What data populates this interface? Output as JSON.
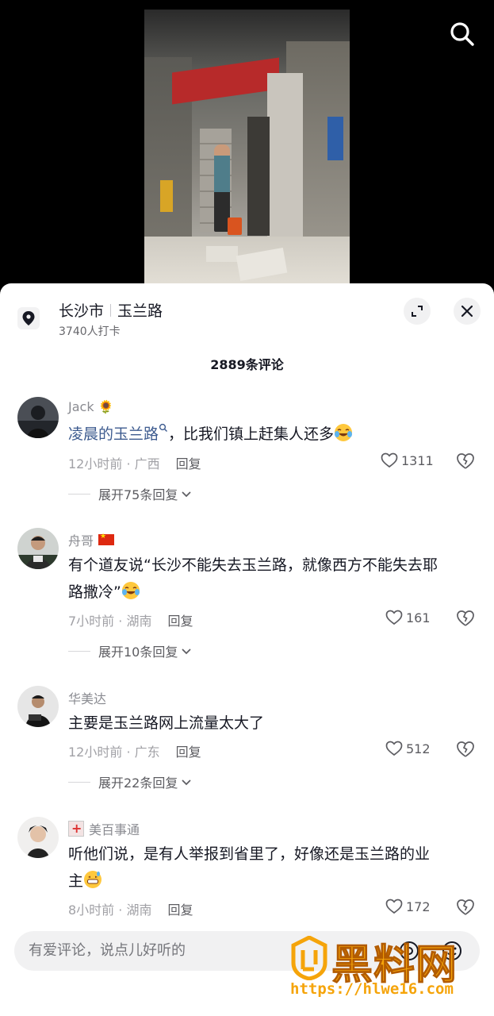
{
  "location": {
    "city": "长沙市",
    "road": "玉兰路",
    "checkins": "3740人打卡"
  },
  "comment_count": "2889条评论",
  "comments": [
    {
      "author": "Jack",
      "badge": "🌻",
      "text_link": "凌晨的玉兰路",
      "text_rest": "，比我们镇上赶集人还多",
      "time_region": "12小时前 · 广西",
      "reply": "回复",
      "likes": "1311",
      "expand": "展开75条回复"
    },
    {
      "author": "舟哥",
      "text_line1": "有个道友说“长沙不能失去玉兰路，就像西方不能失去耶",
      "text_line2": "路撒冷”",
      "time_region": "7小时前 · 湖南",
      "reply": "回复",
      "likes": "161",
      "expand": "展开10条回复"
    },
    {
      "author": "华美达",
      "text_line1": "主要是玉兰路网上流量太大了",
      "time_region": "12小时前 · 广东",
      "reply": "回复",
      "likes": "512",
      "expand": "展开22条回复"
    },
    {
      "author": "美百事通",
      "text_line1": "听他们说，是有人举报到省里了，好像还是玉兰路的业",
      "text_line2": "主",
      "time_region": "8小时前 · 湖南",
      "reply": "回复",
      "likes": "172"
    }
  ],
  "input": {
    "placeholder": "有爱评论，说点儿好听的"
  },
  "watermark": {
    "name": "黑料网",
    "url": "https://hlwe16.com"
  },
  "colors": {
    "accent_link": "#3d5b8f",
    "watermark": "#f5a40a"
  }
}
